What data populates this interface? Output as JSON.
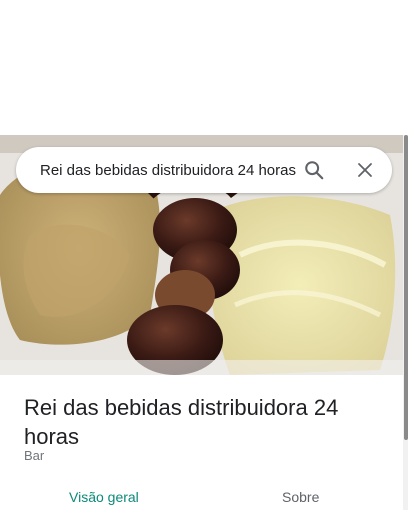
{
  "search": {
    "value": "Rei das bebidas distribuidora 24 horas",
    "search_icon": "search-icon",
    "close_icon": "close-icon"
  },
  "hero": {
    "icon": "food-photo"
  },
  "place": {
    "title": "Rei das bebidas distribuidora 24 horas",
    "category": "Bar"
  },
  "tabs": [
    {
      "label": "Visão geral",
      "active": true
    },
    {
      "label": "Sobre",
      "active": false
    }
  ],
  "colors": {
    "accent": "#0b8a7a",
    "text": "#202124",
    "secondary": "#70757a"
  }
}
